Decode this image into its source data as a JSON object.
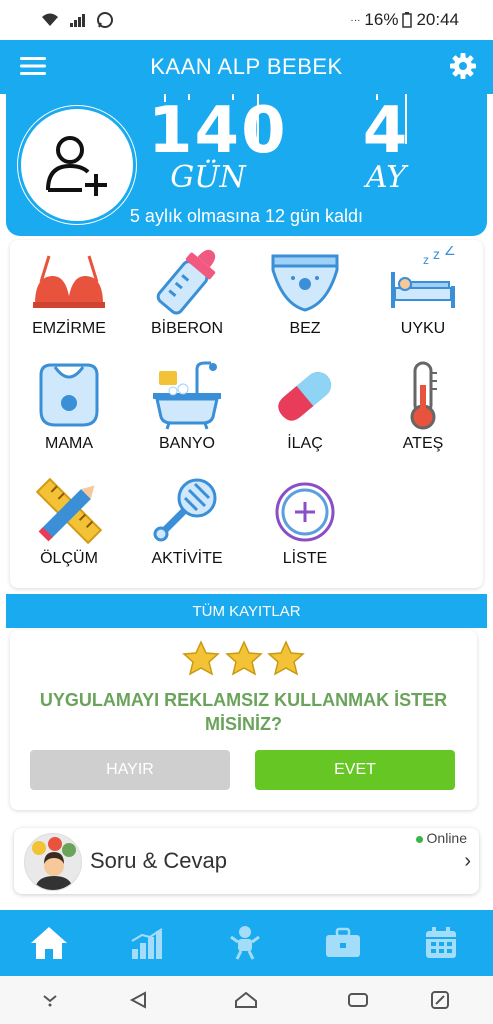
{
  "status_bar": {
    "battery": "16%",
    "time": "20:44"
  },
  "app_bar": {
    "title": "KAAN ALP BEBEK"
  },
  "hero": {
    "days_value": "140",
    "days_unit": "GÜN",
    "months_value": "4",
    "months_unit": "AY",
    "subtitle": "5 aylık olmasına 12 gün kaldı"
  },
  "categories": [
    {
      "label": "EMZİRME",
      "icon": "bra-icon"
    },
    {
      "label": "BİBERON",
      "icon": "baby-bottle-icon"
    },
    {
      "label": "BEZ",
      "icon": "diaper-icon"
    },
    {
      "label": "UYKU",
      "icon": "bed-sleep-icon"
    },
    {
      "label": "MAMA",
      "icon": "bib-icon"
    },
    {
      "label": "BANYO",
      "icon": "bathtub-icon"
    },
    {
      "label": "İLAÇ",
      "icon": "pill-icon"
    },
    {
      "label": "ATEŞ",
      "icon": "thermometer-icon"
    },
    {
      "label": "ÖLÇÜM",
      "icon": "ruler-pencil-icon"
    },
    {
      "label": "AKTİVİTE",
      "icon": "rattle-icon"
    },
    {
      "label": "LİSTE",
      "icon": "add-circle-icon"
    }
  ],
  "records": {
    "label": "TÜM KAYITLAR"
  },
  "ad_free": {
    "question": "UYGULAMAYI REKLAMSIZ KULLANMAK İSTER MİSİNİZ?",
    "no_label": "HAYIR",
    "yes_label": "EVET",
    "stars": 3
  },
  "qa": {
    "title": "Soru & Cevap",
    "status": "Online"
  },
  "colors": {
    "primary": "#1aaaf0",
    "accent_green": "#66c624",
    "question_green": "#6aa35a",
    "disabled_gray": "#cfcfcf"
  },
  "tabs": [
    {
      "icon": "home-icon",
      "active": true
    },
    {
      "icon": "stats-chart-icon",
      "active": false
    },
    {
      "icon": "baby-icon",
      "active": false
    },
    {
      "icon": "briefcase-icon",
      "active": false
    },
    {
      "icon": "calendar-icon",
      "active": false
    }
  ]
}
